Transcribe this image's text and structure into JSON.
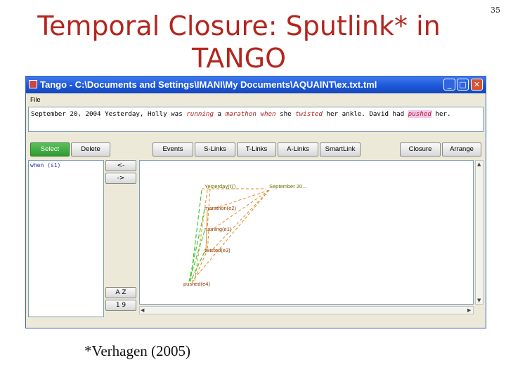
{
  "slide": {
    "title_line1": "Temporal Closure: Sputlink* in",
    "title_line2": "TANGO",
    "number": "35",
    "citation": "*Verhagen (2005)"
  },
  "window": {
    "title": "Tango - C:\\Documents and Settings\\IMANI\\My Documents\\AQUAINT\\ex.txt.tml",
    "controls": {
      "minimize": "_",
      "maximize": "□",
      "close": "✕"
    },
    "menu": [
      "File"
    ]
  },
  "document": {
    "segments": [
      {
        "text": "September 20, 2004 Yesterday, Holly was ",
        "kind": "plain"
      },
      {
        "text": "running",
        "kind": "event"
      },
      {
        "text": " a ",
        "kind": "plain"
      },
      {
        "text": "marathon",
        "kind": "event"
      },
      {
        "text": " ",
        "kind": "plain"
      },
      {
        "text": "when",
        "kind": "signal"
      },
      {
        "text": " she ",
        "kind": "plain"
      },
      {
        "text": "twisted",
        "kind": "event"
      },
      {
        "text": " her ankle. David had ",
        "kind": "plain"
      },
      {
        "text": "pushed",
        "kind": "highlight"
      },
      {
        "text": " her.",
        "kind": "plain"
      }
    ]
  },
  "toolbar": {
    "select": "Select",
    "delete": "Delete",
    "events": "Events",
    "slinks": "S-Links",
    "tlinks": "T-Links",
    "alinks": "A-Links",
    "smartlink": "SmartLink",
    "closure": "Closure",
    "arrange": "Arrange"
  },
  "left_panel": {
    "text": "when (s1)",
    "back_label": "<-",
    "forward_label": "->",
    "sort_az_label": "A Z",
    "sort_19_label": "1 9"
  },
  "graph": {
    "nodes": {
      "yesterday": "Yesterday(t7)",
      "september": "September 20...",
      "marathon": "marathon(e2)",
      "running": "running(e1)",
      "twisted": "twisted(e3)",
      "pushed": "pushed(e4)"
    }
  },
  "colors": {
    "title": "#b3261e",
    "event_text": "#b01e1e",
    "highlight": "#f4c6f0",
    "select_button": "#3aa83a",
    "edge_green": "#44cc33",
    "edge_orange": "#e08a22",
    "titlebar": "#1a55d6"
  },
  "icons": {
    "app": "tango-app-icon",
    "scroll_up": "arrow-up-icon",
    "scroll_down": "arrow-down-icon",
    "scroll_left": "arrow-left-icon",
    "scroll_right": "arrow-right-icon"
  }
}
